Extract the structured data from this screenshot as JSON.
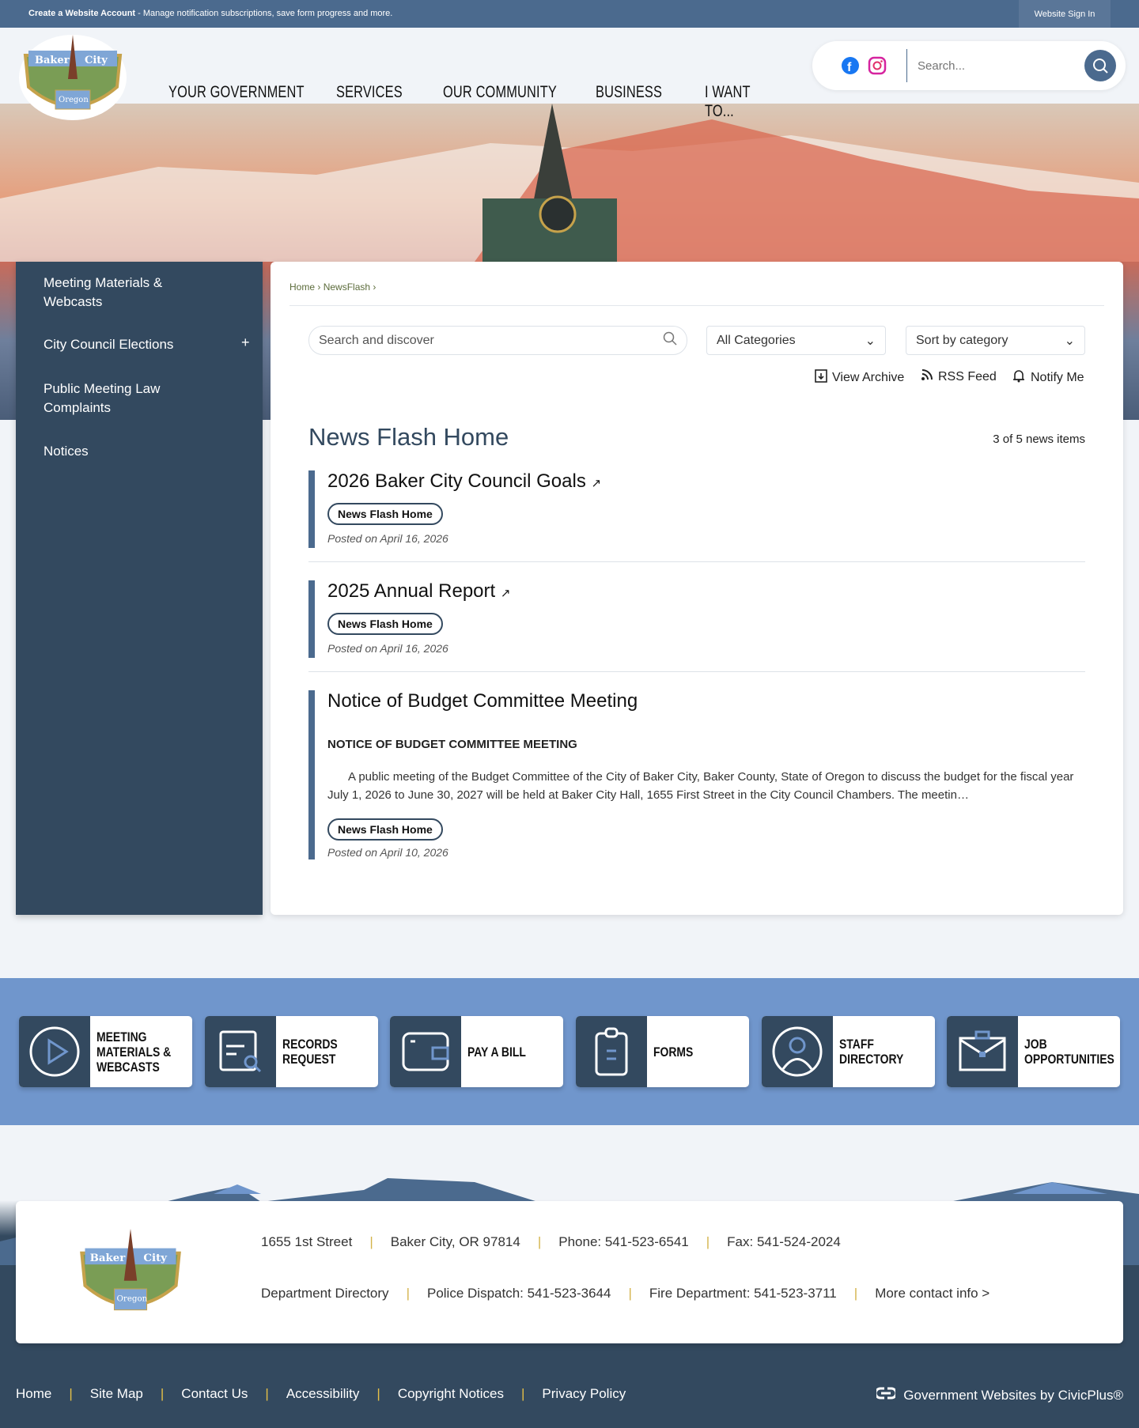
{
  "topbar": {
    "create_account": "Create a Website Account",
    "create_desc": " - Manage notification subscriptions, save form progress and more.",
    "sign_in": "Website Sign In"
  },
  "header": {
    "logo_text": "Baker City Oregon",
    "nav": [
      "YOUR GOVERNMENT",
      "SERVICES",
      "OUR COMMUNITY",
      "BUSINESS",
      "I WANT TO..."
    ],
    "search_placeholder": "Search..."
  },
  "sidebar": {
    "items": [
      {
        "label": "Meeting Materials & Webcasts"
      },
      {
        "label": "City Council Elections",
        "expand": "+"
      },
      {
        "label": "Public Meeting Law Complaints"
      },
      {
        "label": "Notices"
      }
    ]
  },
  "breadcrumb": [
    "Home",
    "NewsFlash"
  ],
  "filters": {
    "search_placeholder": "Search and discover",
    "category": "All Categories",
    "sort": "Sort by category"
  },
  "actions": {
    "archive": "View Archive",
    "rss": "RSS Feed",
    "notify": "Notify Me"
  },
  "news": {
    "title": "News Flash Home",
    "count": "3 of 5 news items",
    "items": [
      {
        "title": "2026 Baker City Council Goals",
        "badge": "News Flash Home",
        "posted": "Posted on April 16, 2026"
      },
      {
        "title": "2025 Annual Report",
        "badge": "News Flash Home",
        "posted": "Posted on April 16, 2026"
      },
      {
        "title": "Notice of Budget Committee Meeting",
        "subheading": "NOTICE OF BUDGET COMMITTEE MEETING",
        "body": "A public meeting of the Budget Committee of the City of Baker City, Baker County, State of Oregon to discuss the budget for the fiscal year July 1, 2026 to June 30, 2027 will be held at Baker City Hall, 1655 First Street in the City Council Chambers. The meetin…",
        "badge": "News Flash Home",
        "posted": "Posted on April 10, 2026"
      }
    ]
  },
  "quicklinks": [
    {
      "label": "MEETING MATERIALS & WEBCASTS",
      "icon": "play-icon"
    },
    {
      "label": "RECORDS REQUEST",
      "icon": "document-search-icon"
    },
    {
      "label": "PAY A BILL",
      "icon": "wallet-icon"
    },
    {
      "label": "FORMS",
      "icon": "clipboard-icon"
    },
    {
      "label": "STAFF DIRECTORY",
      "icon": "user-icon"
    },
    {
      "label": "JOB OPPORTUNITIES",
      "icon": "briefcase-icon"
    }
  ],
  "footer": {
    "row1": [
      "1655 1st Street",
      "Baker City, OR 97814",
      "Phone: 541-523-6541",
      "Fax: 541-524-2024"
    ],
    "row2": [
      "Department Directory",
      "Police Dispatch: 541-523-3644",
      "Fire Department: 541-523-3711",
      "More contact info >"
    ],
    "links": [
      "Home",
      "Site Map",
      "Contact Us",
      "Accessibility",
      "Copyright Notices",
      "Privacy Policy"
    ],
    "civicplus": "Government Websites by CivicPlus®"
  }
}
